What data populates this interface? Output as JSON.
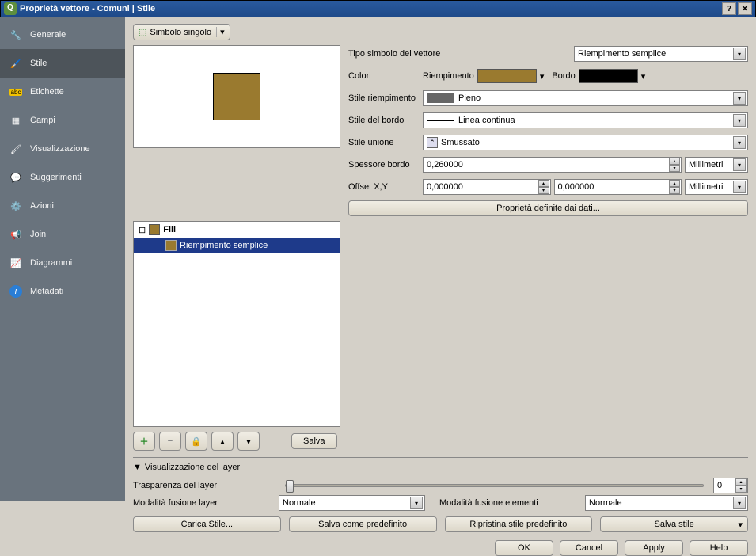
{
  "window": {
    "title": "Proprietà vettore - Comuni | Stile"
  },
  "sidebar": {
    "items": [
      {
        "label": "Generale"
      },
      {
        "label": "Stile"
      },
      {
        "label": "Etichette"
      },
      {
        "label": "Campi"
      },
      {
        "label": "Visualizzazione"
      },
      {
        "label": "Suggerimenti"
      },
      {
        "label": "Azioni"
      },
      {
        "label": "Join"
      },
      {
        "label": "Diagrammi"
      },
      {
        "label": "Metadati"
      }
    ]
  },
  "symbol_mode": "Simbolo singolo",
  "type_label": "Tipo simbolo del vettore",
  "type_value": "Riempimento semplice",
  "colors": {
    "label": "Colori",
    "fill_label": "Riempimento",
    "fill_color": "#9a7a2f",
    "border_label": "Bordo",
    "border_color": "#000000"
  },
  "fill_style": {
    "label": "Stile riempimento",
    "value": "Pieno"
  },
  "border_style": {
    "label": "Stile del bordo",
    "value": "Linea continua"
  },
  "join_style": {
    "label": "Stile unione",
    "value": "Smussato"
  },
  "border_width": {
    "label": "Spessore bordo",
    "value": "0,260000",
    "unit": "Millimetri"
  },
  "offset": {
    "label": "Offset X,Y",
    "x": "0,000000",
    "y": "0,000000",
    "unit": "Millimetri"
  },
  "data_defined_btn": "Proprietà definite dai dati...",
  "tree": {
    "root": "Fill",
    "child": "Riempimento semplice"
  },
  "save_btn": "Salva",
  "layer_render": {
    "header": "Visualizzazione del layer",
    "transparency_label": "Trasparenza del layer",
    "transparency_value": "0",
    "blend_layer_label": "Modalità fusione layer",
    "blend_layer_value": "Normale",
    "blend_feature_label": "Modalità fusione elementi",
    "blend_feature_value": "Normale"
  },
  "bottom": {
    "load": "Carica Stile...",
    "save_default": "Salva come predefinito",
    "restore_default": "Ripristina stile predefinito",
    "save_style": "Salva stile"
  },
  "dialog": {
    "ok": "OK",
    "cancel": "Cancel",
    "apply": "Apply",
    "help": "Help"
  }
}
